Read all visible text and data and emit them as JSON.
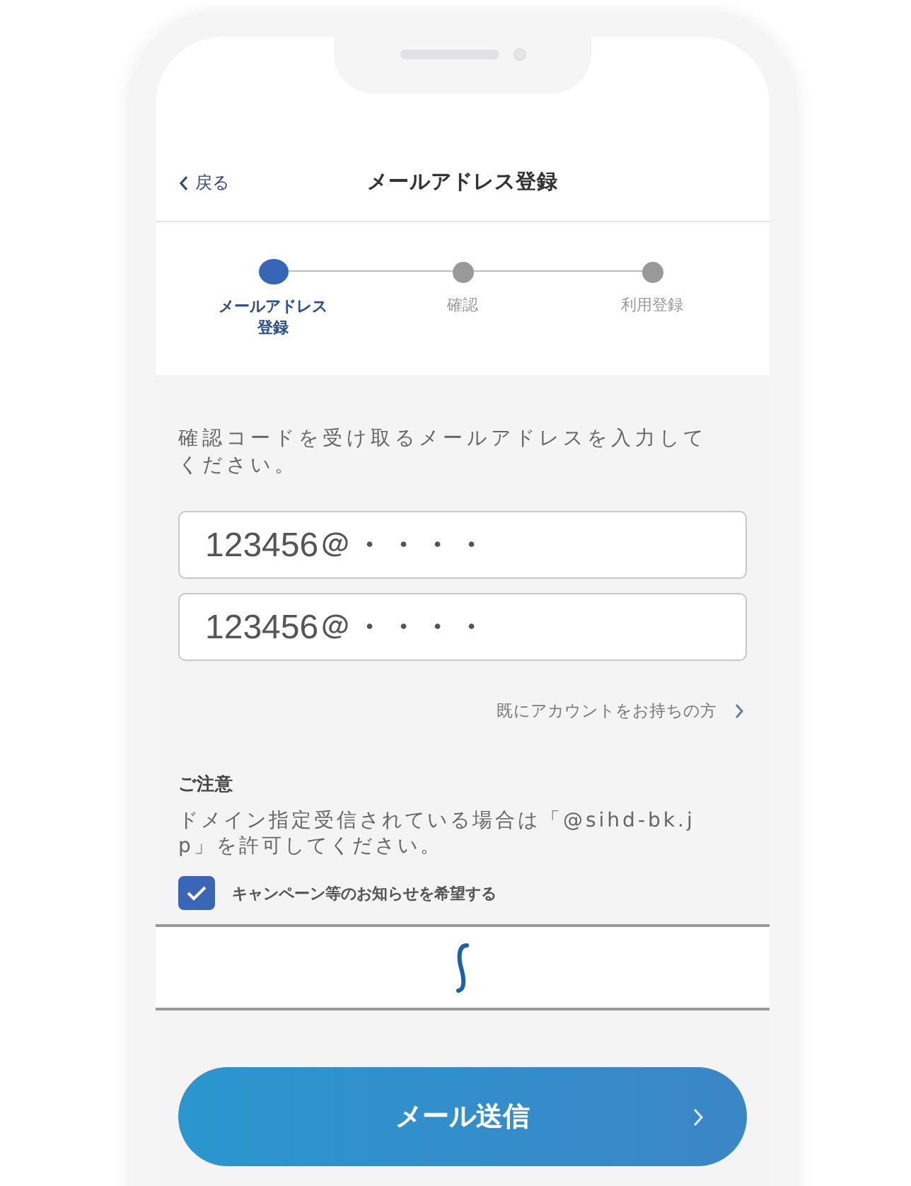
{
  "header": {
    "back": "戻る",
    "title": "メールアドレス登録"
  },
  "steps": [
    {
      "label": "メールアドレス登録",
      "selected": true
    },
    {
      "label": "確認",
      "selected": false
    },
    {
      "label": "利用登録",
      "selected": false
    }
  ],
  "instruction": "確認コードを受け取るメールアドレスを入力してください。",
  "fields": [
    {
      "value": "123456＠・・・・"
    },
    {
      "value": "123456＠・・・・"
    }
  ],
  "account_link": "既にアカウントをお持ちの方",
  "notice": {
    "title": "ご注意",
    "text": "ドメイン指定受信されている場合は「@sihd-bk.jp」を許可してください。"
  },
  "campaign": {
    "label": "キャンペーン等のお知らせを希望する",
    "checked": true
  },
  "submit": "メール送信"
}
